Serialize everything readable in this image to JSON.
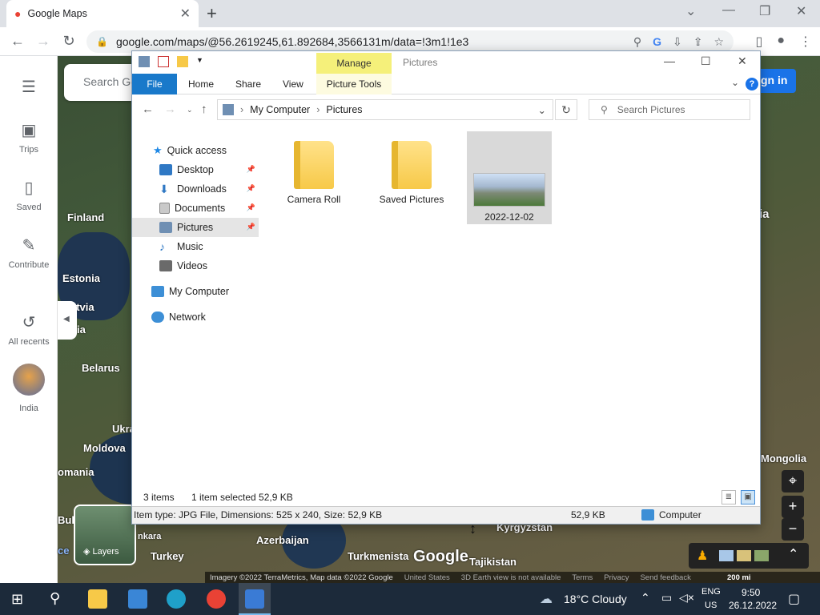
{
  "browser": {
    "tab_title": "Google Maps",
    "url": "google.com/maps/@56.2619245,61.892684,3566131m/data=!3m1!1e3"
  },
  "maps": {
    "search_placeholder": "Search Go",
    "sign_in": "gn in",
    "sidebar": [
      {
        "label": "Trips",
        "icon": "trips-icon"
      },
      {
        "label": "Saved",
        "icon": "bookmark-icon"
      },
      {
        "label": "Contribute",
        "icon": "contribute-icon"
      },
      {
        "label": "All recents",
        "icon": "history-icon"
      },
      {
        "label": "India",
        "icon": "india-avatar"
      }
    ],
    "labels": {
      "finland": "Finland",
      "estonia": "Estonia",
      "latvia": "atvia",
      "lithuania": "ia",
      "belarus": "Belarus",
      "ukraine": "Ukra",
      "moldova": "Moldova",
      "romania": "omania",
      "bulgaria": "Bul",
      "ankara": "nkara",
      "turkey": "Turkey",
      "azerbaijan": "Azerbaijan",
      "turkmenistan": "Turkmenista",
      "kyrgyzstan": "Kyrgyzstan",
      "tajikistan": "Tajikistan",
      "mongolia": "Mongolia",
      "russia_fragment": "ia",
      "ce": "ce"
    },
    "layers_label": "Layers",
    "google_logo": "Google",
    "footer": {
      "imagery": "Imagery ©2022 TerraMetrics, Map data ©2022 Google",
      "country": "United States",
      "earth": "3D Earth view is not available",
      "terms": "Terms",
      "privacy": "Privacy",
      "feedback": "Send feedback",
      "scale": "200 mi"
    }
  },
  "explorer": {
    "title": "Pictures",
    "manage_tab": "Manage",
    "ribbon_tabs": {
      "file": "File",
      "home": "Home",
      "share": "Share",
      "view": "View",
      "picture_tools": "Picture Tools"
    },
    "breadcrumb": [
      "My Computer",
      "Pictures"
    ],
    "search_placeholder": "Search Pictures",
    "nav": [
      {
        "label": "Quick access",
        "color": "#1e88e5"
      },
      {
        "label": "Desktop",
        "color": "#2f78c4"
      },
      {
        "label": "Downloads",
        "color": "#2f78c4"
      },
      {
        "label": "Documents",
        "color": "#8a8a8a"
      },
      {
        "label": "Pictures",
        "color": "#6f8fb3"
      },
      {
        "label": "Music",
        "color": "#2f78c4"
      },
      {
        "label": "Videos",
        "color": "#6a6a6a"
      },
      {
        "label": "My Computer",
        "color": "#3d8fd6"
      },
      {
        "label": "Network",
        "color": "#3d8fd6"
      }
    ],
    "files": [
      {
        "name": "Camera Roll",
        "type": "folder"
      },
      {
        "name": "Saved Pictures",
        "type": "folder"
      },
      {
        "name": "2022-12-02",
        "type": "image"
      }
    ],
    "status": {
      "items": "3 items",
      "selected": "1 item selected  52,9 KB"
    },
    "details": {
      "info": "Item type: JPG File, Dimensions: 525 x 240, Size: 52,9 KB",
      "size": "52,9 KB",
      "location": "Computer"
    }
  },
  "taskbar": {
    "weather": "18°C  Cloudy",
    "lang_top": "ENG",
    "lang_bottom": "US",
    "time": "9:50",
    "date": "26.12.2022"
  }
}
